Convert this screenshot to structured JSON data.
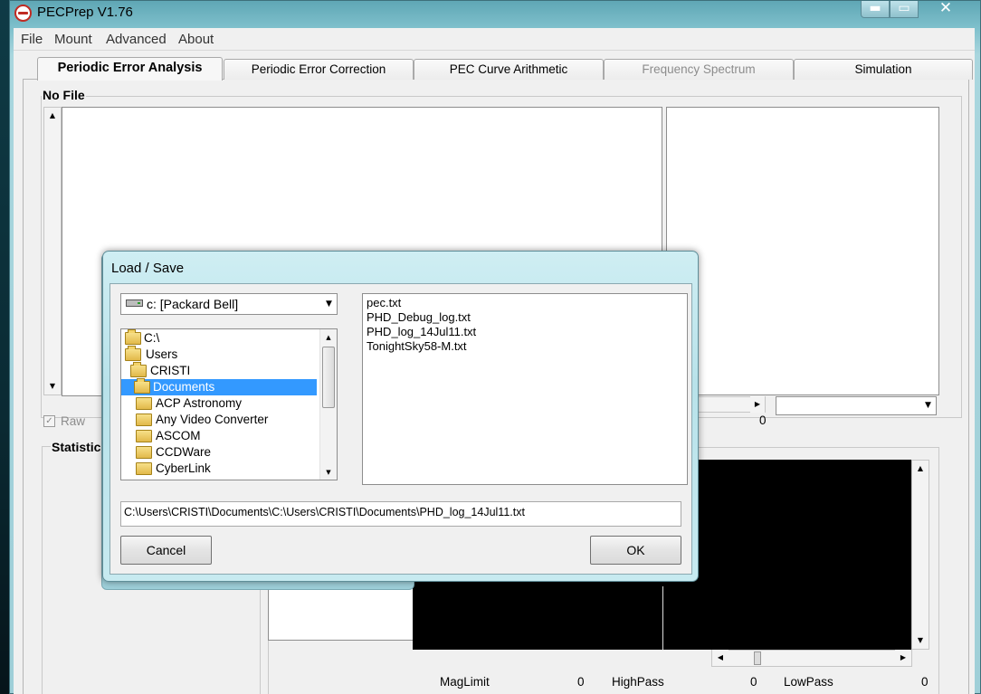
{
  "window": {
    "title": "PECPrep V1.76",
    "minimize_glyph": "▬",
    "maximize_glyph": "▭",
    "close_glyph": "✕"
  },
  "menu": [
    "File",
    "Mount",
    "Advanced",
    "About"
  ],
  "tabs": [
    {
      "label": "Periodic Error Analysis",
      "active": true
    },
    {
      "label": "Periodic Error Correction"
    },
    {
      "label": "PEC Curve Arithmetic"
    },
    {
      "label": "Frequency Spectrum",
      "disabled": true
    },
    {
      "label": "Simulation"
    }
  ],
  "main": {
    "file_group_label": "No File",
    "raw_checkbox_label": "Raw",
    "raw_checked": true,
    "statistics_label": "Statistics",
    "lower_zero_value": "0",
    "filters": [
      {
        "label": "MagLimit",
        "value": "0"
      },
      {
        "label": "HighPass",
        "value": "0"
      },
      {
        "label": "LowPass",
        "value": "0"
      }
    ]
  },
  "dialog": {
    "title": "Load / Save",
    "drive": "c: [Packard Bell]",
    "folders": [
      {
        "name": "C:\\",
        "level": 0,
        "open": true
      },
      {
        "name": "Users",
        "level": 0,
        "open": true
      },
      {
        "name": "CRISTI",
        "level": 1,
        "open": true
      },
      {
        "name": "Documents",
        "level": 1,
        "open": true,
        "selected": true
      },
      {
        "name": "ACP Astronomy",
        "level": 2
      },
      {
        "name": "Any Video Converter",
        "level": 2
      },
      {
        "name": "ASCOM",
        "level": 2
      },
      {
        "name": "CCDWare",
        "level": 2
      },
      {
        "name": "CyberLink",
        "level": 2
      }
    ],
    "files": [
      "pec.txt",
      "PHD_Debug_log.txt",
      "PHD_log_14Jul11.txt",
      "TonightSky58-M.txt"
    ],
    "path": "C:\\Users\\CRISTI\\Documents\\C:\\Users\\CRISTI\\Documents\\PHD_log_14Jul11.txt",
    "cancel_label": "Cancel",
    "ok_label": "OK"
  },
  "colors": {
    "selection": "#3399ff",
    "chart_background": "#000000",
    "window_frame": "#7fc0cc"
  }
}
